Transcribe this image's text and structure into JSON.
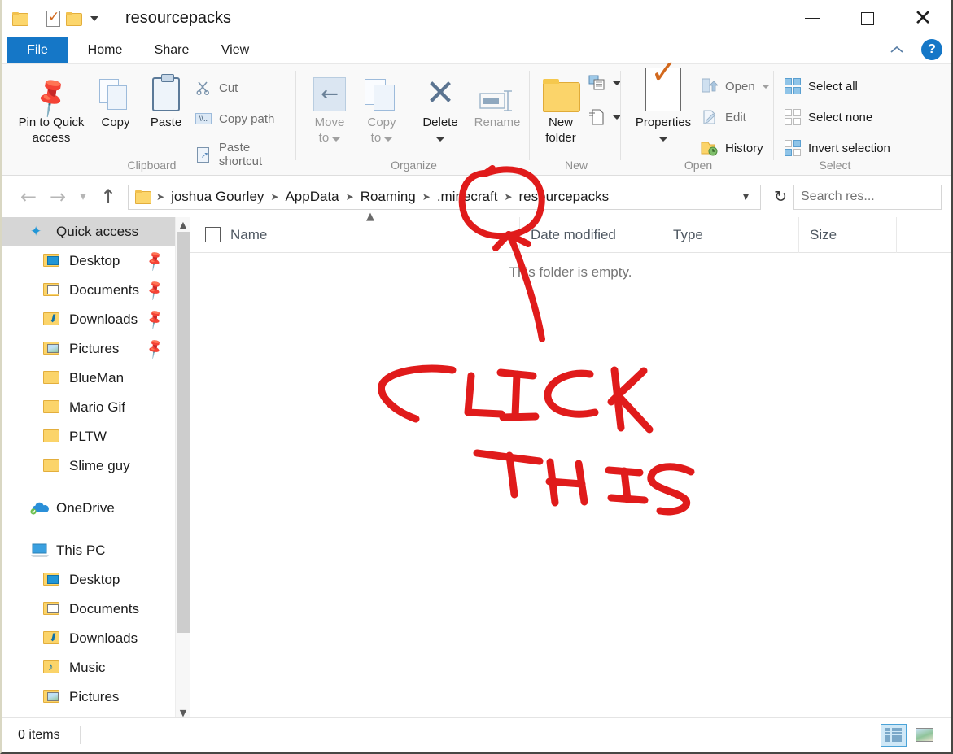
{
  "window": {
    "title": "resourcepacks",
    "qat": {
      "folder_icon": "folder-icon",
      "properties_icon": "properties-check-icon",
      "new_folder_icon": "new-folder-icon",
      "customize_caret": "chevron-down-icon"
    },
    "controls": {
      "minimize": "minimize-icon",
      "maximize": "maximize-icon",
      "close": "close-icon"
    }
  },
  "ribbon": {
    "tabs": [
      {
        "label": "File",
        "id": "file"
      },
      {
        "label": "Home",
        "id": "home"
      },
      {
        "label": "Share",
        "id": "share"
      },
      {
        "label": "View",
        "id": "view"
      }
    ],
    "active_tab": "Home",
    "collapse_icon": "chevron-up-icon",
    "help_label": "?",
    "groups": [
      {
        "name": "Clipboard",
        "big_buttons": [
          {
            "label": "Pin to Quick\naccess",
            "line1": "Pin to Quick",
            "line2": "access",
            "icon": "pin-icon"
          },
          {
            "label": "Copy",
            "icon": "copy-icon"
          },
          {
            "label": "Paste",
            "icon": "paste-icon"
          }
        ],
        "small_buttons": [
          {
            "label": "Cut",
            "icon": "scissors-icon"
          },
          {
            "label": "Copy path",
            "icon": "copy-path-icon"
          },
          {
            "label": "Paste shortcut",
            "icon": "paste-shortcut-icon"
          }
        ]
      },
      {
        "name": "Organize",
        "big_buttons": [
          {
            "line1": "Move",
            "line2": "to",
            "label": "Move to",
            "icon": "move-to-icon",
            "has_caret": true
          },
          {
            "line1": "Copy",
            "line2": "to",
            "label": "Copy to",
            "icon": "copy-to-icon",
            "has_caret": true
          },
          {
            "label": "Delete",
            "icon": "delete-x-icon",
            "has_caret": true
          },
          {
            "label": "Rename",
            "icon": "rename-icon",
            "disabled": true
          }
        ]
      },
      {
        "name": "New",
        "big_buttons": [
          {
            "line1": "New",
            "line2": "folder",
            "label": "New folder",
            "icon": "new-folder-icon"
          }
        ],
        "small_buttons": [
          {
            "label": "",
            "icon": "new-item-icon",
            "has_caret": true
          },
          {
            "label": "",
            "icon": "easy-access-icon",
            "has_caret": true
          }
        ]
      },
      {
        "name": "Open",
        "big_buttons": [
          {
            "label": "Properties",
            "icon": "properties-check-icon",
            "has_caret": true
          }
        ],
        "small_buttons": [
          {
            "label": "Open",
            "icon": "open-icon",
            "has_caret": true,
            "disabled": true
          },
          {
            "label": "Edit",
            "icon": "edit-icon",
            "disabled": true
          },
          {
            "label": "History",
            "icon": "history-icon"
          }
        ]
      },
      {
        "name": "Select",
        "small_buttons": [
          {
            "label": "Select all",
            "icon": "select-all-icon"
          },
          {
            "label": "Select none",
            "icon": "select-none-icon"
          },
          {
            "label": "Invert selection",
            "icon": "invert-selection-icon"
          }
        ]
      }
    ]
  },
  "address": {
    "back_icon": "back-arrow-icon",
    "forward_icon": "forward-arrow-icon",
    "recent_icon": "chevron-down-icon",
    "up_icon": "up-arrow-icon",
    "folder_icon": "folder-icon",
    "breadcrumbs": [
      "joshua Gourley",
      "AppData",
      "Roaming",
      ".minecraft",
      "resourcepacks"
    ],
    "dropdown_icon": "chevron-down-icon",
    "refresh_icon": "refresh-icon",
    "search": {
      "placeholder": "Search res...",
      "value": "",
      "icon": "search-icon"
    }
  },
  "navpane": {
    "sections": [
      {
        "header": {
          "label": "Quick access",
          "icon": "star-pin-icon",
          "selected": true
        },
        "items": [
          {
            "label": "Desktop",
            "icon": "desktop-folder-icon",
            "pinned": true
          },
          {
            "label": "Documents",
            "icon": "documents-folder-icon",
            "pinned": true
          },
          {
            "label": "Downloads",
            "icon": "downloads-folder-icon",
            "pinned": true
          },
          {
            "label": "Pictures",
            "icon": "pictures-folder-icon",
            "pinned": true
          },
          {
            "label": "BlueMan",
            "icon": "folder-icon",
            "pinned": false
          },
          {
            "label": "Mario Gif",
            "icon": "folder-icon",
            "pinned": false
          },
          {
            "label": "PLTW",
            "icon": "folder-icon",
            "pinned": false
          },
          {
            "label": "Slime guy",
            "icon": "folder-icon",
            "pinned": false
          }
        ]
      },
      {
        "header": {
          "label": "OneDrive",
          "icon": "onedrive-cloud-icon",
          "selected": false
        },
        "items": []
      },
      {
        "header": {
          "label": "This PC",
          "icon": "this-pc-icon",
          "selected": false
        },
        "items": [
          {
            "label": "Desktop",
            "icon": "desktop-folder-icon",
            "pinned": false
          },
          {
            "label": "Documents",
            "icon": "documents-folder-icon",
            "pinned": false
          },
          {
            "label": "Downloads",
            "icon": "downloads-folder-icon",
            "pinned": false
          },
          {
            "label": "Music",
            "icon": "music-folder-icon",
            "pinned": false
          },
          {
            "label": "Pictures",
            "icon": "pictures-folder-icon",
            "pinned": false
          }
        ]
      }
    ],
    "scroll": {
      "up_icon": "chevron-up-icon",
      "down_icon": "chevron-down-icon"
    }
  },
  "filelist": {
    "columns": [
      {
        "label": "Name",
        "sorted": true,
        "sort_icon": "chevron-up-icon"
      },
      {
        "label": "Date modified"
      },
      {
        "label": "Type"
      },
      {
        "label": "Size"
      }
    ],
    "empty_message": "This folder is empty.",
    "rows": []
  },
  "statusbar": {
    "item_count": "0 items",
    "views": [
      {
        "name": "details-view",
        "label": "Details view",
        "active": true
      },
      {
        "name": "large-icons-view",
        "label": "Large icons view",
        "active": false
      }
    ]
  },
  "annotation": {
    "color": "#e01b1b",
    "circle_target": ".minecraft",
    "text_line1": "CLICK",
    "text_line2": "THIS"
  }
}
